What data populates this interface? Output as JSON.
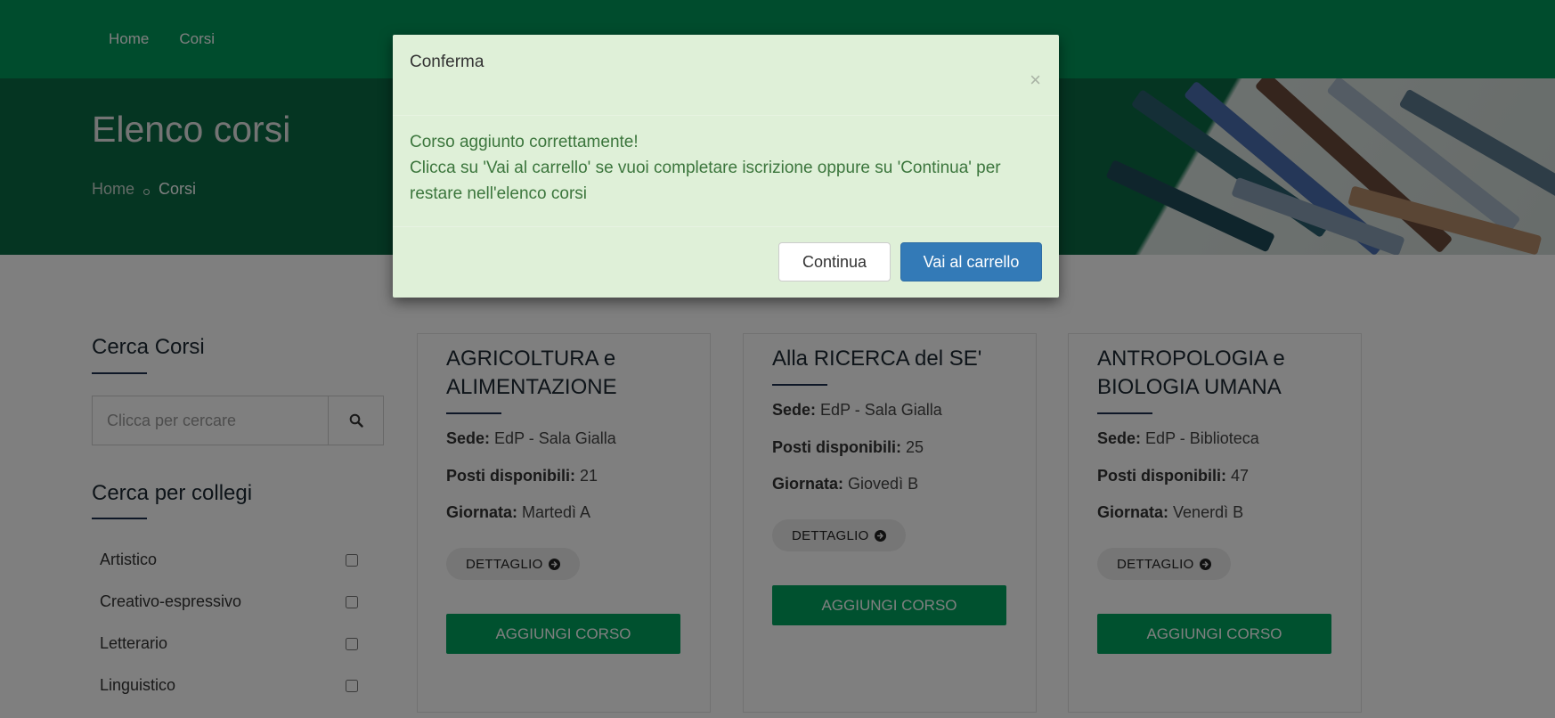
{
  "nav": {
    "items": [
      "Home",
      "Corsi"
    ]
  },
  "hero": {
    "title": "Elenco corsi",
    "breadcrumb_home": "Home",
    "breadcrumb_current": "Corsi"
  },
  "sidebar": {
    "search_title": "Cerca Corsi",
    "search_placeholder": "Clicca per cercare",
    "search_icon": "search-icon",
    "colleges_title": "Cerca per collegi",
    "colleges": [
      "Artistico",
      "Creativo-espressivo",
      "Letterario",
      "Linguistico"
    ]
  },
  "labels": {
    "sede": "Sede:",
    "posti": "Posti disponibili:",
    "giornata": "Giornata:",
    "detail_button": "DETTAGLIO",
    "add_button": "AGGIUNGI CORSO"
  },
  "courses": [
    {
      "title": "AGRICOLTURA e ALIMENTAZIONE",
      "sede": "EdP - Sala Gialla",
      "posti": "21",
      "giornata": "Martedì A"
    },
    {
      "title": "Alla RICERCA del SE'",
      "sede": "EdP - Sala Gialla",
      "posti": "25",
      "giornata": "Giovedì B"
    },
    {
      "title": "ANTROPOLOGIA e BIOLOGIA UMANA",
      "sede": "EdP - Biblioteca",
      "posti": "47",
      "giornata": "Venerdì B"
    }
  ],
  "modal": {
    "title": "Conferma",
    "close_symbol": "×",
    "line1": "Corso aggiunto correttamente!",
    "line2": "Clicca su 'Vai al carrello' se vuoi completare iscrizione oppure su 'Continua' per restare nell'elenco corsi",
    "continue_label": "Continua",
    "cart_label": "Vai al carrello"
  },
  "colors": {
    "nav_green": "#00995a",
    "button_green": "#00a35f",
    "modal_bg": "#dff0d8",
    "modal_text": "#3c763d",
    "primary_blue": "#337ab7"
  }
}
